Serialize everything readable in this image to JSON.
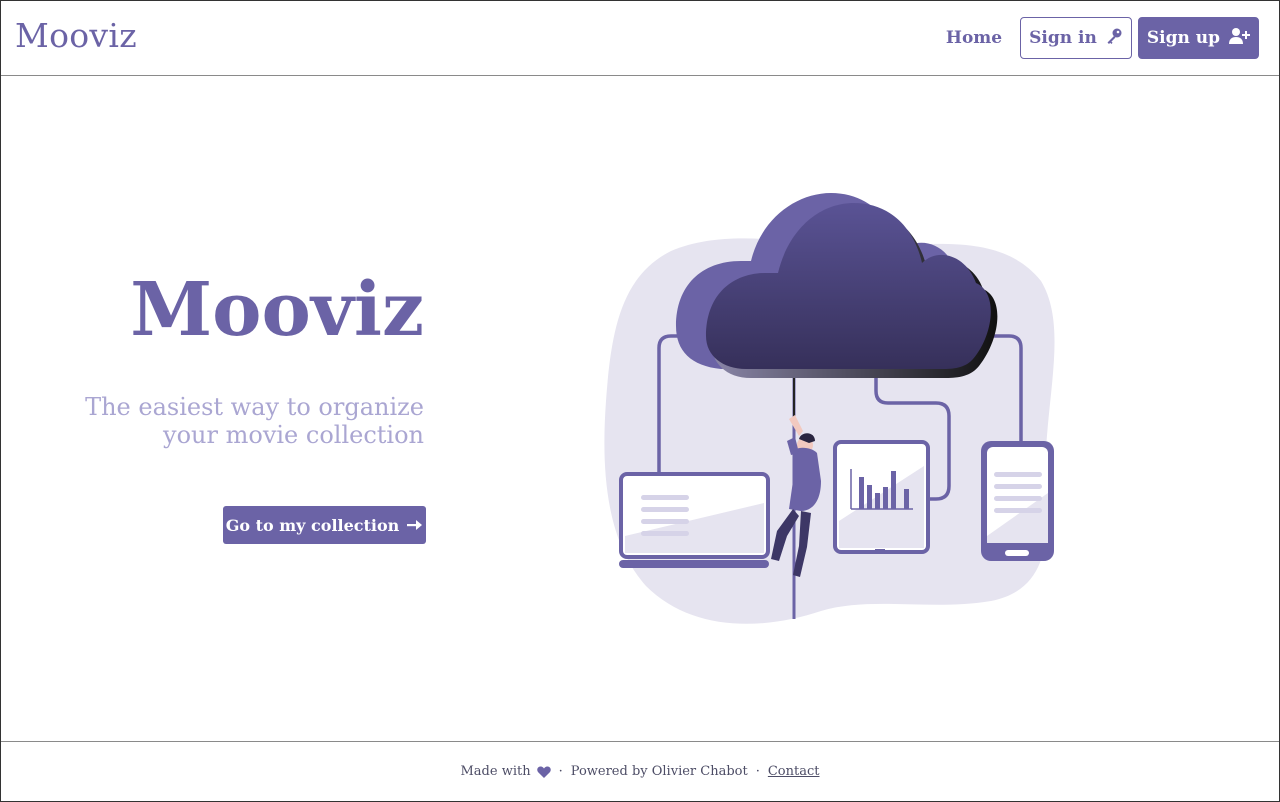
{
  "header": {
    "brand": "Mooviz",
    "nav": {
      "home": "Home",
      "sign_in": "Sign in",
      "sign_up": "Sign up"
    },
    "icons": {
      "sign_in": "key-icon",
      "sign_up": "user-plus-icon"
    }
  },
  "hero": {
    "title": "Mooviz",
    "subtitle_line1": "The easiest way to organize",
    "subtitle_line2": "your movie collection",
    "cta_label": "Go to my collection",
    "cta_icon": "arrow-right-icon"
  },
  "footer": {
    "made_with": "Made with",
    "heart_icon": "heart-icon",
    "separator": "·",
    "powered_by": "Powered by Olivier Chabot",
    "contact": "Contact"
  },
  "colors": {
    "primary": "#6b63a6",
    "subtitle": "#aaa6d2",
    "blob": "#e6e4f0",
    "cloud_dark": "#3d3766"
  }
}
